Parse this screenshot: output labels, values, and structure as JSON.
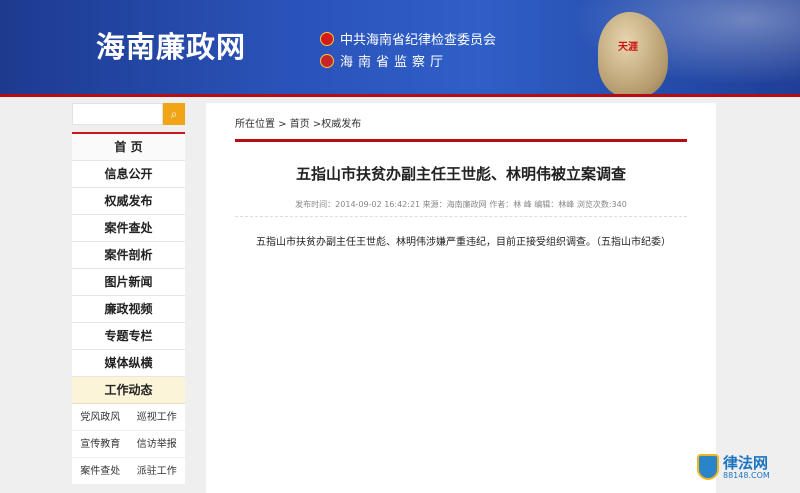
{
  "header": {
    "site_title": "海南廉政网",
    "org1": "中共海南省纪律检查委员会",
    "org2": "海南省监察厅",
    "rock_text": "天涯"
  },
  "sidebar": {
    "search_icon": "search-icon",
    "nav": [
      "首 页",
      "信息公开",
      "权威发布",
      "案件查处",
      "案件剖析",
      "图片新闻",
      "廉政视频",
      "专题专栏",
      "媒体纵横"
    ],
    "work_header": "工作动态",
    "work_items": [
      "党风政风",
      "巡视工作",
      "宣传教育",
      "信访举报",
      "案件查处",
      "派驻工作"
    ]
  },
  "content": {
    "breadcrumb": "所在位置 > 首页 >权威发布",
    "title": "五指山市扶贫办副主任王世彪、林明伟被立案调查",
    "meta": "发布时间：2014-09-02 16:42:21 来源：海南廉政网 作者：林 峰   编辑：林峰 浏览次数:340",
    "body": "五指山市扶贫办副主任王世彪、林明伟涉嫌严重违纪，目前正接受组织调查。（五指山市纪委）"
  },
  "watermark": {
    "name": "律法网",
    "url": "88148.COM"
  },
  "colors": {
    "header_blue": "#1d3a8f",
    "red_accent": "#b50d12",
    "search_orange": "#f2a417"
  }
}
